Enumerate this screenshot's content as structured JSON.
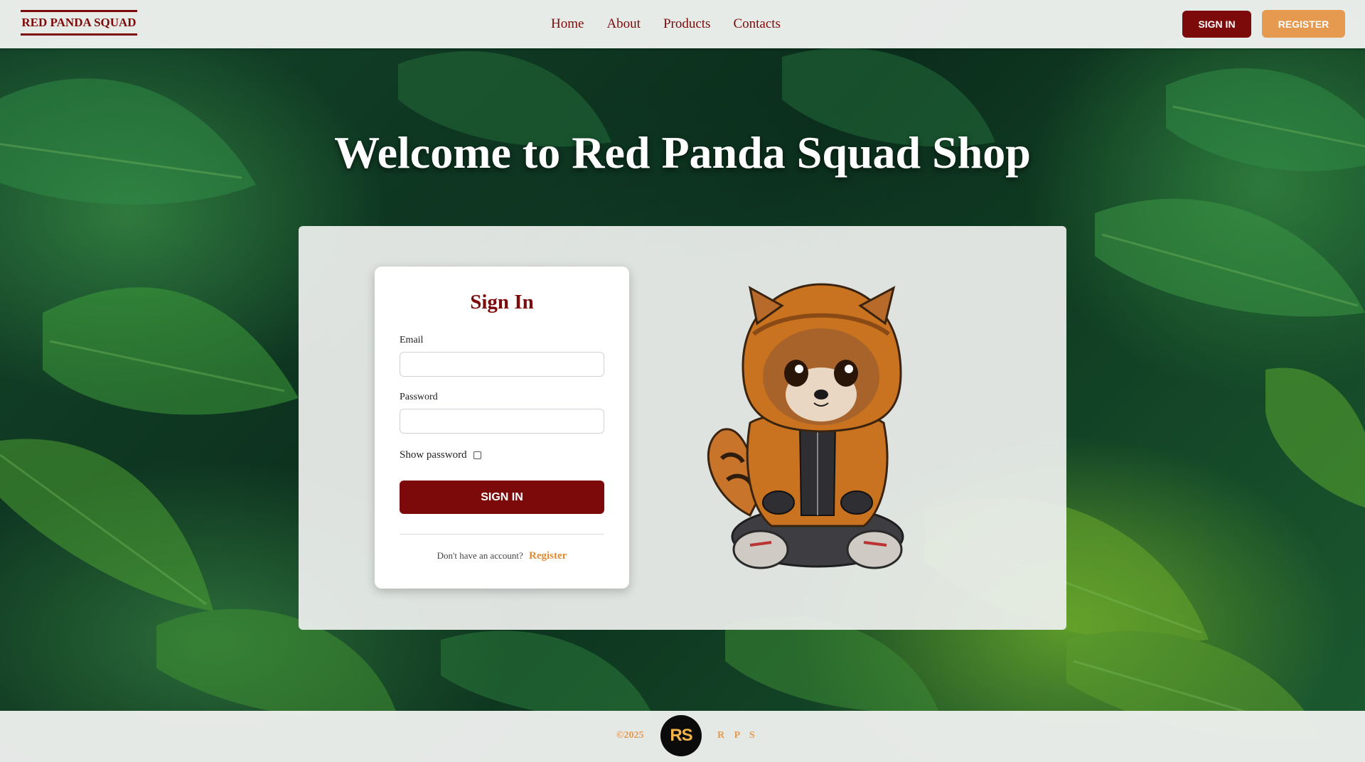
{
  "nav": {
    "brand": "RED PANDA SQUAD",
    "links": [
      "Home",
      "About",
      "Products",
      "Contacts"
    ],
    "signin_label": "SIGN IN",
    "register_label": "REGISTER"
  },
  "hero": {
    "title": "Welcome to Red Panda Squad Shop"
  },
  "signin_card": {
    "title": "Sign In",
    "email_label": "Email",
    "email_value": "",
    "password_label": "Password",
    "password_value": "",
    "show_password_label": "Show password",
    "show_password_checked": false,
    "submit_label": "SIGN IN",
    "no_account_text": "Don't have an account?",
    "register_link": "Register"
  },
  "footer": {
    "copyright": "©2025",
    "logo_text": "RS",
    "tag": "R P S"
  },
  "colors": {
    "brand_red": "#7d0a0a",
    "accent_orange": "#e69a50",
    "panel_bg": "#eef0ee"
  }
}
